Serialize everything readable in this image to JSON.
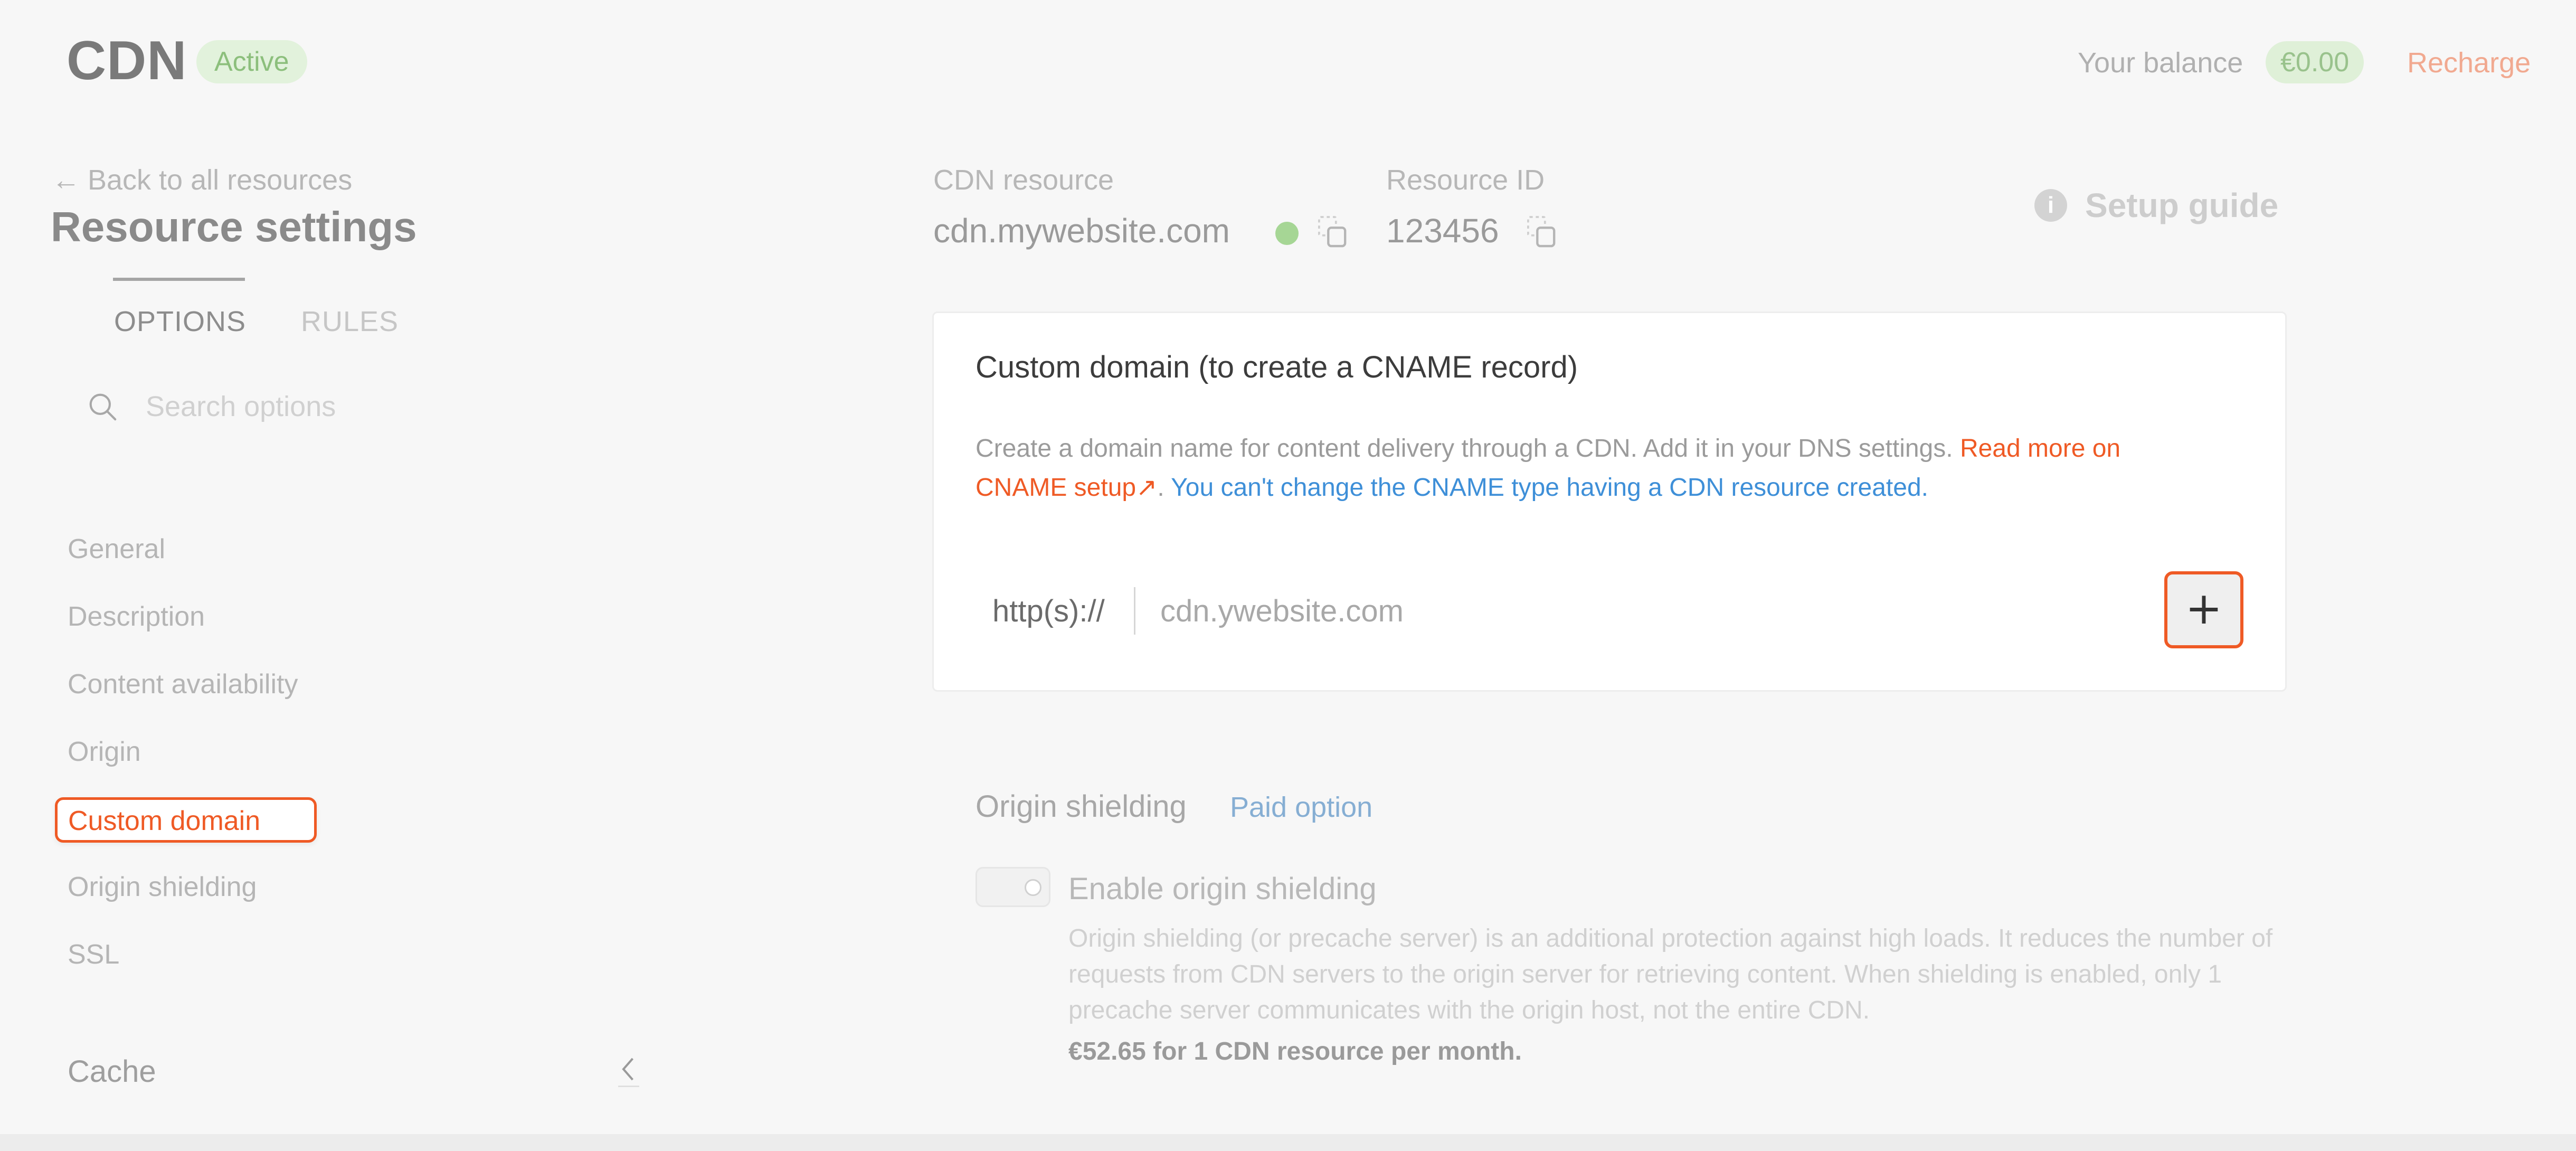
{
  "header": {
    "app_title": "CDN",
    "status_badge": "Active",
    "balance_label": "Your balance",
    "balance_value": "€0.00",
    "recharge": "Recharge"
  },
  "sidebar": {
    "back_link": "Back to all resources",
    "title": "Resource settings",
    "tabs": [
      {
        "label": "OPTIONS",
        "active": true
      },
      {
        "label": "RULES",
        "active": false
      }
    ],
    "search_placeholder": "Search options",
    "items": [
      {
        "label": "General"
      },
      {
        "label": "Description"
      },
      {
        "label": "Content availability"
      },
      {
        "label": "Origin"
      },
      {
        "label": "Custom domain",
        "active": true
      },
      {
        "label": "Origin shielding"
      },
      {
        "label": "SSL"
      }
    ],
    "group_cache": "Cache"
  },
  "resource": {
    "cdn_label": "CDN resource",
    "cdn_value": "cdn.mywebsite.com",
    "id_label": "Resource ID",
    "id_value": "123456",
    "setup_guide": "Setup guide"
  },
  "custom_domain": {
    "title": "Custom domain (to create a CNAME record)",
    "description": "Create a domain name for content delivery through a CDN. Add it in your DNS settings.",
    "read_more_part1": "Read more on",
    "read_more_part2": "CNAME setup",
    "note": "You can't change the CNAME type having a CDN resource created.",
    "prefix": "http(s)://",
    "placeholder": "cdn.ywebsite.com",
    "add_button": "+"
  },
  "origin_shielding": {
    "title": "Origin shielding",
    "paid_option": "Paid option",
    "toggle_label": "Enable origin shielding",
    "toggle_on": false,
    "description": "Origin shielding (or precache server) is an additional protection against high loads. It reduces the number of requests from CDN servers to the origin server for retrieving content. When shielding is enabled, only 1 precache server communicates with the origin host, not the entire CDN.",
    "price": "€52.65 for 1 CDN resource per month."
  },
  "colors": {
    "accent": "#ef5a25",
    "link_blue": "#3e8fd8",
    "success": "#a6d695"
  }
}
